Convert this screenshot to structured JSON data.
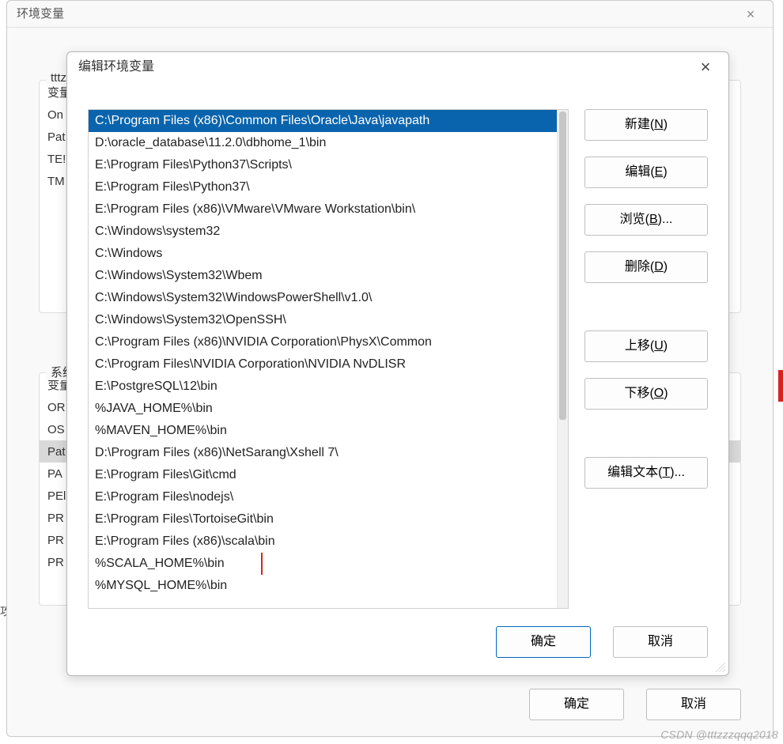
{
  "outer": {
    "title": "环境变量",
    "close": "×",
    "user_label_partial": "tttzz",
    "user_group_header": "变量",
    "user_rows": [
      "On",
      "Pat",
      "TE!",
      "TM"
    ],
    "sys_label_partial": "系统变",
    "sys_group_header": "变量",
    "sys_rows": [
      "OR",
      "OS",
      "Pat",
      "PA",
      "PEl",
      "PR",
      "PR",
      "PR"
    ],
    "sys_selected_index": 2,
    "ok": "确定",
    "cancel": "取消"
  },
  "inner": {
    "title": "编辑环境变量",
    "close": "×",
    "selected_index": 0,
    "boxed_index": 20,
    "entries": [
      "C:\\Program Files (x86)\\Common Files\\Oracle\\Java\\javapath",
      "D:\\oracle_database\\11.2.0\\dbhome_1\\bin",
      "E:\\Program Files\\Python37\\Scripts\\",
      "E:\\Program Files\\Python37\\",
      "E:\\Program Files (x86)\\VMware\\VMware Workstation\\bin\\",
      "C:\\Windows\\system32",
      "C:\\Windows",
      "C:\\Windows\\System32\\Wbem",
      "C:\\Windows\\System32\\WindowsPowerShell\\v1.0\\",
      "C:\\Windows\\System32\\OpenSSH\\",
      "C:\\Program Files (x86)\\NVIDIA Corporation\\PhysX\\Common",
      "C:\\Program Files\\NVIDIA Corporation\\NVIDIA NvDLISR",
      "E:\\PostgreSQL\\12\\bin",
      "%JAVA_HOME%\\bin",
      "%MAVEN_HOME%\\bin",
      "D:\\Program Files (x86)\\NetSarang\\Xshell 7\\",
      "E:\\Program Files\\Git\\cmd",
      "E:\\Program Files\\nodejs\\",
      "E:\\Program Files\\TortoiseGit\\bin",
      "E:\\Program Files (x86)\\scala\\bin",
      "%SCALA_HOME%\\bin",
      "%MYSQL_HOME%\\bin"
    ],
    "buttons": {
      "new": {
        "t": "新建(",
        "k": "N",
        "s": ")"
      },
      "edit": {
        "t": "编辑(",
        "k": "E",
        "s": ")"
      },
      "browse": {
        "t": "浏览(",
        "k": "B",
        "s": ")..."
      },
      "delete": {
        "t": "删除(",
        "k": "D",
        "s": ")"
      },
      "up": {
        "t": "上移(",
        "k": "U",
        "s": ")"
      },
      "down": {
        "t": "下移(",
        "k": "O",
        "s": ")"
      },
      "edittxt": {
        "t": "编辑文本(",
        "k": "T",
        "s": ")..."
      }
    },
    "ok": "确定",
    "cancel": "取消"
  },
  "watermark": "CSDN @tttzzzqqq2018",
  "bg_cut": "攻"
}
